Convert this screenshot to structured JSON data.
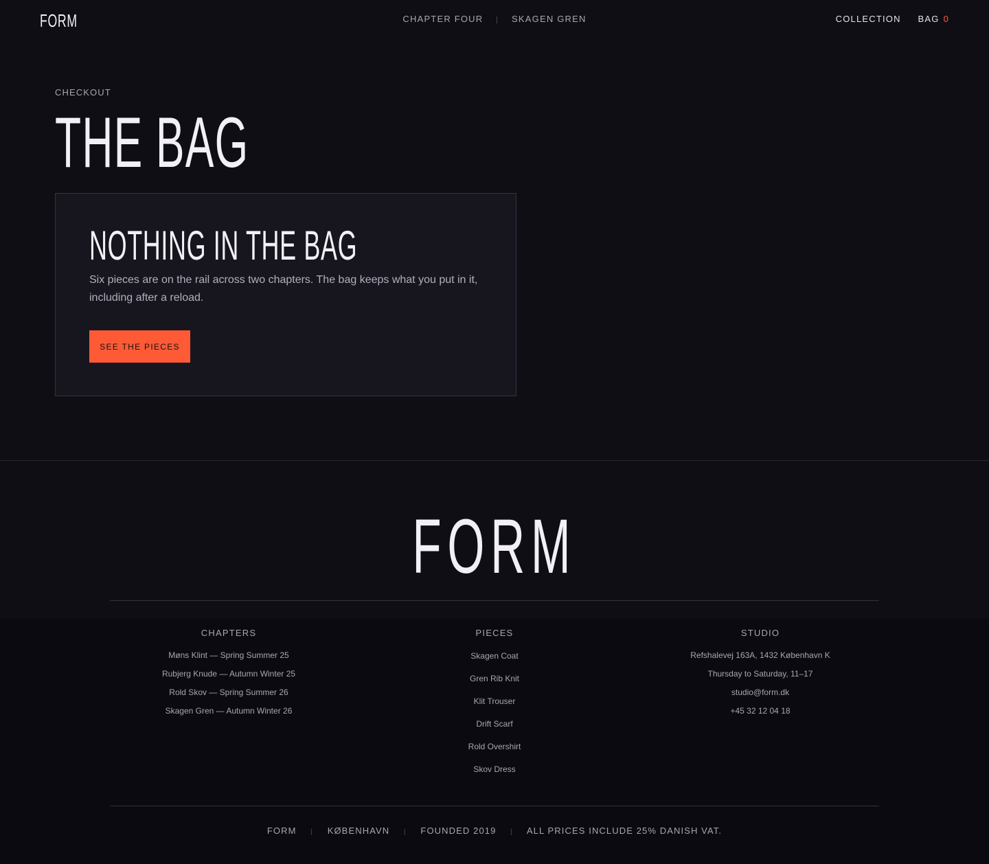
{
  "header": {
    "logo": "FORM",
    "nav": [
      "CHAPTER FOUR",
      "SKAGEN GREN"
    ],
    "right_links": {
      "collection": "COLLECTION",
      "bag": "BAG",
      "bag_count": "0"
    }
  },
  "hero": {
    "eyebrow": "CHECKOUT",
    "title": "THE BAG"
  },
  "empty_state": {
    "title": "NOTHING IN THE BAG",
    "text": "Six pieces are on the rail across two chapters. The bag keeps what you put in it, including after a reload.",
    "button": "SEE THE PIECES"
  },
  "footer": {
    "logo": "FORM",
    "columns": {
      "chapters": {
        "heading": "CHAPTERS",
        "items": [
          "Møns Klint — Spring Summer 25",
          "Rubjerg Knude — Autumn Winter 25",
          "Rold Skov — Spring Summer 26",
          "Skagen Gren — Autumn Winter 26"
        ]
      },
      "pieces": {
        "heading": "PIECES",
        "items": [
          "Skagen Coat",
          "Gren Rib Knit",
          "Klit Trouser",
          "Drift Scarf",
          "Rold Overshirt",
          "Skov Dress"
        ]
      },
      "studio": {
        "heading": "STUDIO",
        "items": [
          "Refshalevej 163A, 1432 København K",
          "Thursday to Saturday, 11–17",
          "studio@form.dk",
          "+45 32 12 04 18"
        ]
      }
    },
    "bottom": [
      "FORM",
      "KØBENHAVN",
      "FOUNDED 2019",
      "ALL PRICES INCLUDE 25% DANISH VAT."
    ]
  },
  "colors": {
    "background": "#0f0e14",
    "accent": "#ff5a36",
    "card": "#17161f"
  }
}
